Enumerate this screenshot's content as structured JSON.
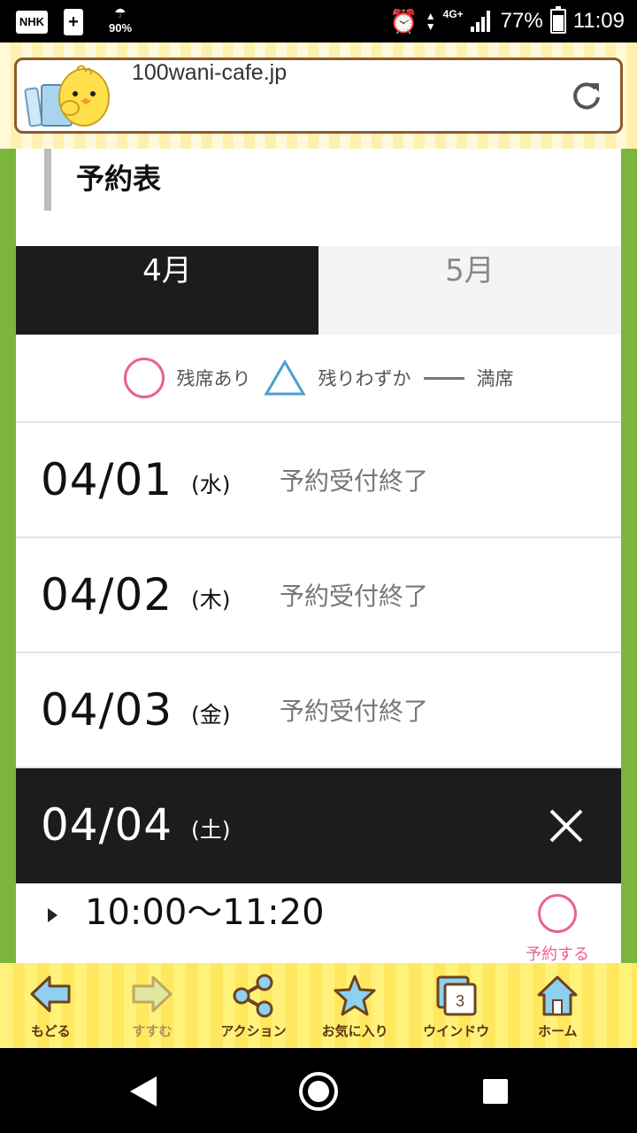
{
  "status_bar": {
    "nhk": "NHK",
    "battery_saver": "+",
    "weather_pct": "90%",
    "network": "4G+",
    "battery": "77%",
    "battery_level": 0.77,
    "time": "11:09"
  },
  "browser": {
    "url": "100wani-cafe.jp"
  },
  "page": {
    "section_title": "予約表",
    "tabs": [
      {
        "label": "4月",
        "active": true
      },
      {
        "label": "5月",
        "active": false
      }
    ],
    "legend": [
      {
        "icon": "circle",
        "label": "残席あり"
      },
      {
        "icon": "triangle",
        "label": "残りわずか"
      },
      {
        "icon": "dash",
        "label": "満席"
      }
    ],
    "days": [
      {
        "date": "04/01",
        "dow": "(水)",
        "status": "予約受付終了"
      },
      {
        "date": "04/02",
        "dow": "(木)",
        "status": "予約受付終了"
      },
      {
        "date": "04/03",
        "dow": "(金)",
        "status": "予約受付終了"
      },
      {
        "date": "04/04",
        "dow": "(土)",
        "status": ""
      }
    ],
    "slots": [
      {
        "time": "10:00〜11:20",
        "availability": "circle",
        "reserve_label": "予約する"
      }
    ]
  },
  "toolbar": [
    {
      "label": "もどる",
      "icon": "back-arrow-icon"
    },
    {
      "label": "すすむ",
      "icon": "forward-arrow-icon"
    },
    {
      "label": "アクション",
      "icon": "share-icon"
    },
    {
      "label": "お気に入り",
      "icon": "star-icon"
    },
    {
      "label": "ウインドウ",
      "icon": "window-icon",
      "count": "3"
    },
    {
      "label": "ホーム",
      "icon": "home-icon"
    }
  ],
  "colors": {
    "accent_green": "#7cb53c",
    "circle_pink": "#e8628c",
    "triangle_blue": "#4aa0d0",
    "dark": "#1c1c1c",
    "toolbar_yellow": "#fff27a",
    "toolbar_text": "#5a3518"
  }
}
